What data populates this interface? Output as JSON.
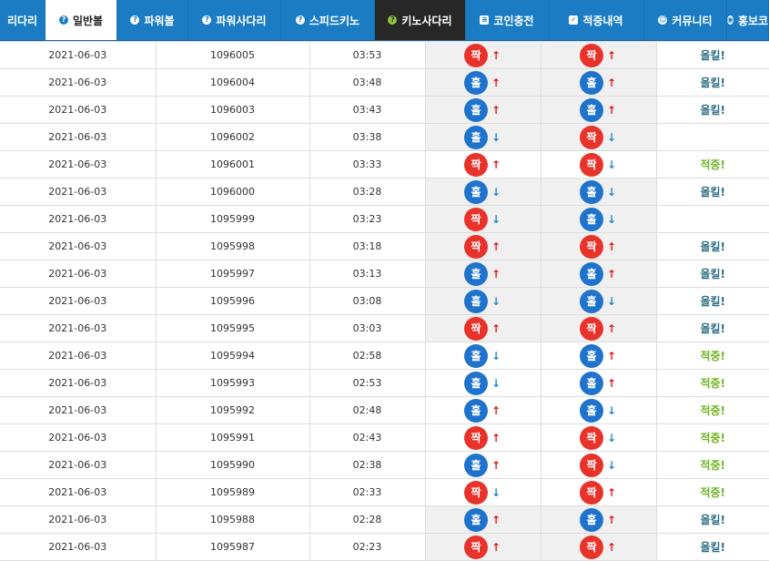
{
  "nav": {
    "tabs": [
      {
        "label": "리다리",
        "icon": "",
        "state": "normal",
        "name": "tab-ladder"
      },
      {
        "label": "일반볼",
        "icon": "?",
        "state": "active",
        "name": "tab-normal-ball"
      },
      {
        "label": "파워볼",
        "icon": "?",
        "state": "normal",
        "name": "tab-powerball"
      },
      {
        "label": "파워사다리",
        "icon": "?",
        "state": "normal",
        "name": "tab-power-ladder"
      },
      {
        "label": "스피드키노",
        "icon": "?",
        "state": "normal",
        "name": "tab-speed-keno"
      },
      {
        "label": "키노사다리",
        "icon": "?",
        "state": "dark",
        "name": "tab-keno-ladder"
      },
      {
        "label": "코인충전",
        "icon": "≡",
        "state": "normal",
        "name": "tab-coin-charge"
      },
      {
        "label": "적중내역",
        "icon": "✓",
        "state": "normal",
        "name": "tab-hit-history"
      },
      {
        "label": "커뮤니티",
        "icon": "☺",
        "state": "normal",
        "name": "tab-community"
      },
      {
        "label": "홍보코",
        "icon": "◉",
        "state": "normal",
        "name": "tab-promo"
      }
    ]
  },
  "colors": {
    "odd": "#e8332b",
    "even": "#1f73cc",
    "arrow_up": "#d9201c",
    "arrow_down": "#2589c8",
    "res_allkill": "#2b6d84",
    "res_hit": "#6db322"
  },
  "legend": {
    "odd": "짝",
    "even": "홀"
  },
  "result_text": {
    "allkill": "올킬!",
    "hit": "적중!"
  },
  "rows": [
    {
      "date": "2021-06-03",
      "round": "1096005",
      "time": "03:53",
      "p1": {
        "r": "짝",
        "d": "up"
      },
      "p2": {
        "r": "짝",
        "d": "up"
      },
      "result": "올킬!",
      "bg": "grey"
    },
    {
      "date": "2021-06-03",
      "round": "1096004",
      "time": "03:48",
      "p1": {
        "r": "홀",
        "d": "up"
      },
      "p2": {
        "r": "홀",
        "d": "up"
      },
      "result": "올킬!",
      "bg": "grey"
    },
    {
      "date": "2021-06-03",
      "round": "1096003",
      "time": "03:43",
      "p1": {
        "r": "홀",
        "d": "up"
      },
      "p2": {
        "r": "홀",
        "d": "up"
      },
      "result": "올킬!",
      "bg": "grey"
    },
    {
      "date": "2021-06-03",
      "round": "1096002",
      "time": "03:38",
      "p1": {
        "r": "홀",
        "d": "down"
      },
      "p2": {
        "r": "짝",
        "d": "down"
      },
      "result": "",
      "bg": "grey"
    },
    {
      "date": "2021-06-03",
      "round": "1096001",
      "time": "03:33",
      "p1": {
        "r": "짝",
        "d": "up"
      },
      "p2": {
        "r": "짝",
        "d": "down"
      },
      "result": "적중!",
      "bg": "white"
    },
    {
      "date": "2021-06-03",
      "round": "1096000",
      "time": "03:28",
      "p1": {
        "r": "홀",
        "d": "down"
      },
      "p2": {
        "r": "홀",
        "d": "down"
      },
      "result": "올킬!",
      "bg": "grey"
    },
    {
      "date": "2021-06-03",
      "round": "1095999",
      "time": "03:23",
      "p1": {
        "r": "짝",
        "d": "down"
      },
      "p2": {
        "r": "홀",
        "d": "down"
      },
      "result": "",
      "bg": "grey"
    },
    {
      "date": "2021-06-03",
      "round": "1095998",
      "time": "03:18",
      "p1": {
        "r": "짝",
        "d": "up"
      },
      "p2": {
        "r": "짝",
        "d": "up"
      },
      "result": "올킬!",
      "bg": "grey"
    },
    {
      "date": "2021-06-03",
      "round": "1095997",
      "time": "03:13",
      "p1": {
        "r": "홀",
        "d": "up"
      },
      "p2": {
        "r": "홀",
        "d": "up"
      },
      "result": "올킬!",
      "bg": "grey"
    },
    {
      "date": "2021-06-03",
      "round": "1095996",
      "time": "03:08",
      "p1": {
        "r": "홀",
        "d": "down"
      },
      "p2": {
        "r": "홀",
        "d": "down"
      },
      "result": "올킬!",
      "bg": "grey"
    },
    {
      "date": "2021-06-03",
      "round": "1095995",
      "time": "03:03",
      "p1": {
        "r": "짝",
        "d": "up"
      },
      "p2": {
        "r": "짝",
        "d": "up"
      },
      "result": "올킬!",
      "bg": "grey"
    },
    {
      "date": "2021-06-03",
      "round": "1095994",
      "time": "02:58",
      "p1": {
        "r": "홀",
        "d": "down"
      },
      "p2": {
        "r": "홀",
        "d": "up"
      },
      "result": "적중!",
      "bg": "white"
    },
    {
      "date": "2021-06-03",
      "round": "1095993",
      "time": "02:53",
      "p1": {
        "r": "홀",
        "d": "down"
      },
      "p2": {
        "r": "홀",
        "d": "up"
      },
      "result": "적중!",
      "bg": "white"
    },
    {
      "date": "2021-06-03",
      "round": "1095992",
      "time": "02:48",
      "p1": {
        "r": "홀",
        "d": "up"
      },
      "p2": {
        "r": "홀",
        "d": "down"
      },
      "result": "적중!",
      "bg": "white"
    },
    {
      "date": "2021-06-03",
      "round": "1095991",
      "time": "02:43",
      "p1": {
        "r": "짝",
        "d": "up"
      },
      "p2": {
        "r": "짝",
        "d": "down"
      },
      "result": "적중!",
      "bg": "white"
    },
    {
      "date": "2021-06-03",
      "round": "1095990",
      "time": "02:38",
      "p1": {
        "r": "홀",
        "d": "up"
      },
      "p2": {
        "r": "짝",
        "d": "down"
      },
      "result": "적중!",
      "bg": "white"
    },
    {
      "date": "2021-06-03",
      "round": "1095989",
      "time": "02:33",
      "p1": {
        "r": "짝",
        "d": "down"
      },
      "p2": {
        "r": "짝",
        "d": "up"
      },
      "result": "적중!",
      "bg": "white"
    },
    {
      "date": "2021-06-03",
      "round": "1095988",
      "time": "02:28",
      "p1": {
        "r": "홀",
        "d": "up"
      },
      "p2": {
        "r": "홀",
        "d": "up"
      },
      "result": "올킬!",
      "bg": "grey"
    },
    {
      "date": "2021-06-03",
      "round": "1095987",
      "time": "02:23",
      "p1": {
        "r": "짝",
        "d": "up"
      },
      "p2": {
        "r": "짝",
        "d": "up"
      },
      "result": "올킬!",
      "bg": "grey"
    }
  ]
}
